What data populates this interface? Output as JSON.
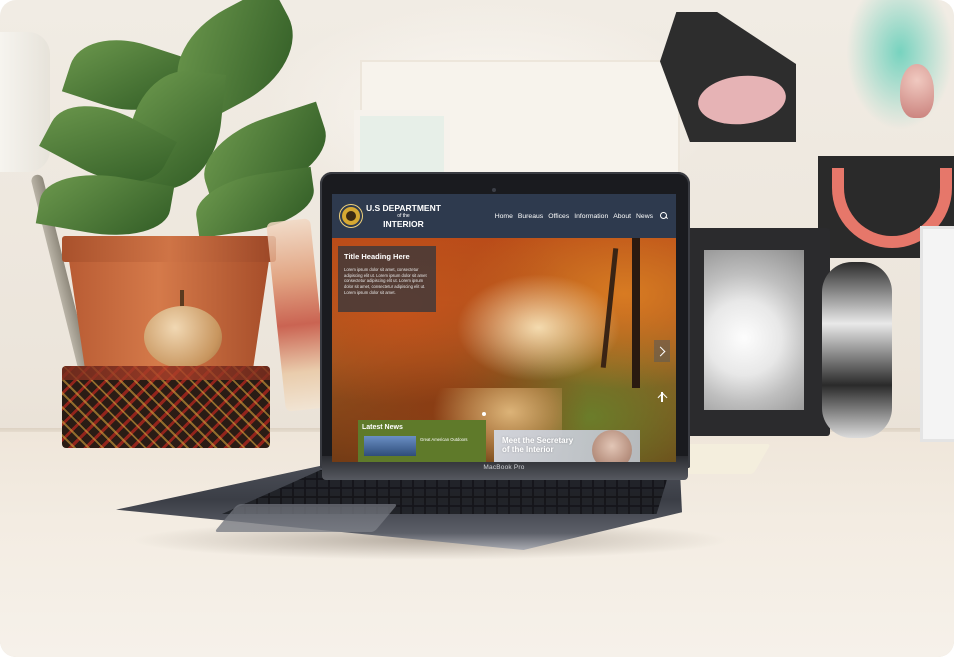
{
  "site": {
    "dept_line1": "U.S DEPARTMENT",
    "dept_line2": "of the",
    "dept_line3": "INTERIOR",
    "nav": [
      "Home",
      "Bureaus",
      "Offices",
      "Information",
      "About",
      "News"
    ],
    "colors": {
      "header": "#2e3a4e",
      "accent_gold": "#d7a932",
      "news_green": "#5f7a2a"
    }
  },
  "hero": {
    "title": "Title Heading Here",
    "body": "Lorem ipsum dolor sit amet, consectetur adipiscing elit ut. Lorem ipsum dolor sit amet consectetur adipiscing elit ut. Lorem ipsum dolor sit amet, consectetur adipiscing elit ut. Lorem ipsum dolor sit amet."
  },
  "latest_news": {
    "heading": "Latest News",
    "item": "Great American Outdoors"
  },
  "secretary": {
    "label": "Meet the Secretary of the Interior"
  },
  "laptop": {
    "brand": "MacBook Pro"
  },
  "icons": [
    "search-icon",
    "chevron-right-icon",
    "arrow-up-icon",
    "department-seal-icon"
  ]
}
